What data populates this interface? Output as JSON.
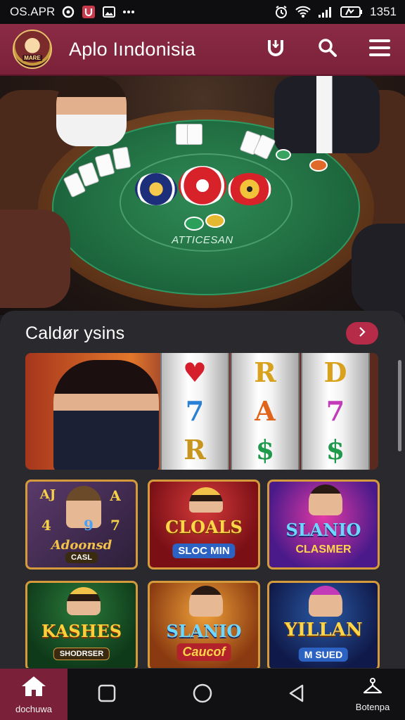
{
  "status_bar": {
    "time_left": "OS.APR",
    "time_right": "1351",
    "icons": [
      "record-icon",
      "app-u-icon",
      "photo-icon",
      "more-dots-icon",
      "alarm-icon",
      "wifi-icon",
      "signal-icon",
      "battery-icon"
    ]
  },
  "header": {
    "logo_text": "MARE",
    "title": "Aplo Iındonisia",
    "actions": [
      "brand-u-icon",
      "search-icon",
      "menu-icon"
    ]
  },
  "hero": {
    "table_label": "ATTICESAN"
  },
  "section": {
    "title": "Caldør ysins",
    "more_icon": "chevron-right-icon"
  },
  "banner": {
    "reels": [
      [
        "♥",
        "7",
        "R"
      ],
      [
        "R",
        "A",
        "$"
      ],
      [
        "D",
        "7",
        "$"
      ]
    ]
  },
  "tiles": [
    {
      "title": "Adoonsd",
      "subtitle": "CASL",
      "symbols": [
        "AJ",
        "4",
        "A",
        "9",
        "7"
      ]
    },
    {
      "title": "CLOALS",
      "subtitle": "SLOC MIN"
    },
    {
      "title": "SLANIO",
      "subtitle": "CLASMER"
    },
    {
      "title": "KASHES",
      "subtitle": "SHODRSER"
    },
    {
      "title": "SLANIO",
      "subtitle": "Caucof"
    },
    {
      "title": "YILLAN",
      "subtitle": "M SUED"
    }
  ],
  "bottom_nav": {
    "home_label": "dochuwa",
    "profile_label": "Botenpa"
  },
  "colors": {
    "header": "#8c2b45",
    "accent": "#b52b48",
    "panel": "#2a2a2e",
    "felt": "#1f6b40"
  }
}
